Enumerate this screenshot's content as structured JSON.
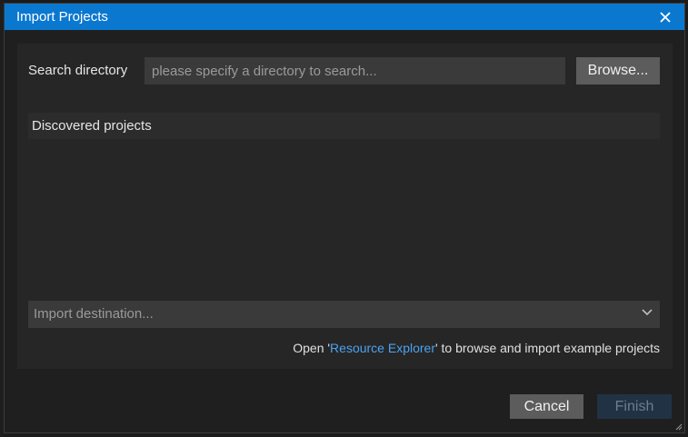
{
  "dialog": {
    "title": "Import Projects",
    "close_icon": "close-icon"
  },
  "search": {
    "label": "Search directory",
    "placeholder": "please specify a directory to search...",
    "value": "",
    "browse_label": "Browse..."
  },
  "discovered": {
    "header": "Discovered projects",
    "items": []
  },
  "destination": {
    "placeholder": "Import destination...",
    "chevron_icon": "chevron-down-icon"
  },
  "hint": {
    "prefix": "Open '",
    "link": "Resource Explorer",
    "suffix": "' to browse and import example projects"
  },
  "footer": {
    "cancel_label": "Cancel",
    "finish_label": "Finish"
  },
  "colors": {
    "titlebar": "#0b78d0",
    "link": "#4aa3f0",
    "disabled_button": "#213244"
  }
}
